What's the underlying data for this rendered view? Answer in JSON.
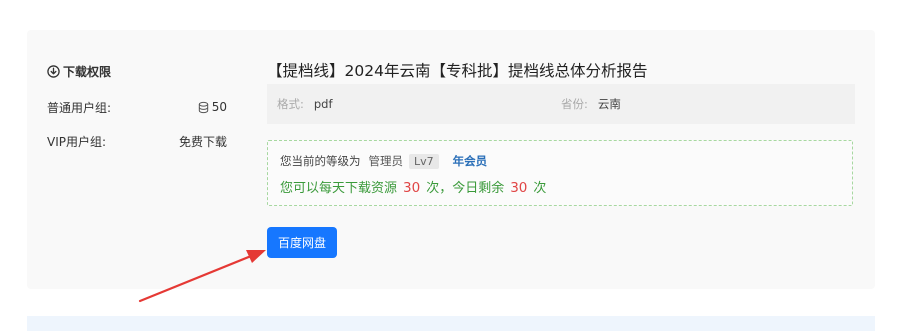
{
  "sidebar": {
    "title": "下载权限",
    "title_icon": "download-circle-icon",
    "rows": [
      {
        "label": "普通用户组:",
        "value": "50",
        "icon": "coins-icon"
      },
      {
        "label": "VIP用户组:",
        "value": "免费下载"
      }
    ]
  },
  "document": {
    "title": "【提档线】2024年云南【专科批】提档线总体分析报告",
    "format_label": "格式:",
    "format_value": "pdf",
    "province_label": "省份:",
    "province_value": "云南"
  },
  "notice": {
    "level_prefix": "您当前的等级为",
    "role": "管理员",
    "level": "Lv7",
    "membership": "年会员",
    "quota_prefix": "您可以每天下载资源",
    "daily_count": "30",
    "quota_mid": "次，今日剩余",
    "remaining_count": "30",
    "quota_suffix": "次"
  },
  "actions": {
    "download_button": "百度网盘"
  },
  "colors": {
    "accent": "#1677ff",
    "success_text": "#3a9a3a",
    "number_highlight": "#e04545",
    "member_link": "#2a6fb8",
    "annotation_arrow": "#e53935"
  }
}
